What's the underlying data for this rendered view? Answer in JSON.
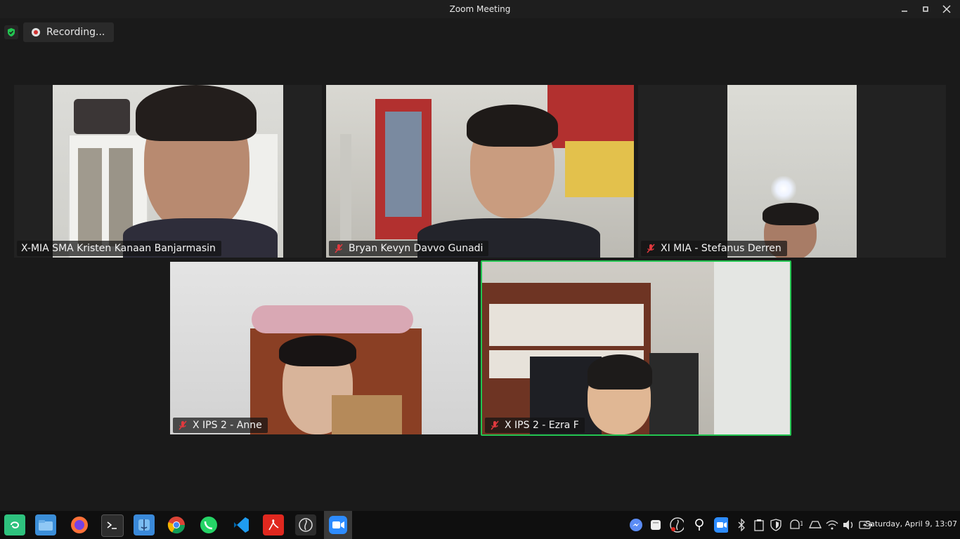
{
  "window": {
    "title": "Zoom Meeting"
  },
  "recording": {
    "label": "Recording..."
  },
  "participants": [
    {
      "name": "X-MIA SMA Kristen Kanaan Banjarmasin",
      "muted": false,
      "active": false
    },
    {
      "name": "Bryan Kevyn Davvo Gunadi",
      "muted": true,
      "active": false
    },
    {
      "name": "XI MIA - Stefanus Derren",
      "muted": true,
      "active": false
    },
    {
      "name": "X IPS 2 - Anne",
      "muted": true,
      "active": false
    },
    {
      "name": "X IPS 2 - Ezra F",
      "muted": true,
      "active": true
    }
  ],
  "taskbar": {
    "apps": [
      "gnome-software-icon",
      "files-icon",
      "firefox-icon",
      "terminal-icon",
      "finder-icon",
      "chrome-icon",
      "whatsapp-icon",
      "vscode-icon",
      "pdf-reader-icon",
      "obs-icon",
      "zoom-icon"
    ],
    "clock": "Saturday, April  9, 13:07"
  },
  "colors": {
    "active_border": "#23c551",
    "muted_mic": "#e0393e"
  }
}
